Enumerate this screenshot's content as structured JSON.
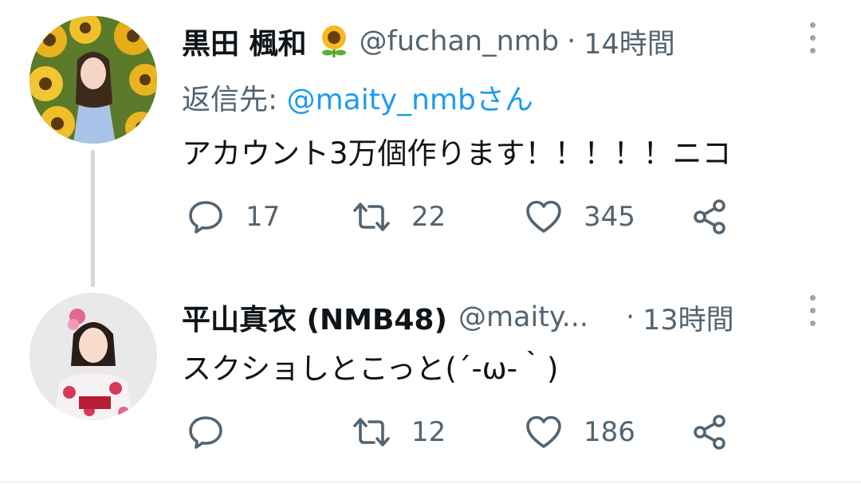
{
  "tweets": [
    {
      "display_name": "黒田 楓和",
      "name_emoji": "sunflower-emoji",
      "handle": "@fuchan_nmb",
      "separator": "·",
      "time": "14時間",
      "reply_label": "返信先: ",
      "reply_handle": "@maity_nmbさん",
      "text": "アカウント3万個作ります！！！！！ニコ",
      "replies": "17",
      "retweets": "22",
      "likes": "345"
    },
    {
      "display_name": "平山真衣 (NMB48)",
      "handle": "@maity...",
      "separator": "·",
      "time": "13時間",
      "text": "スクショしとこっと(´-ω-｀)",
      "replies": "",
      "retweets": "12",
      "likes": "186"
    }
  ],
  "icons": [
    "reply-icon",
    "retweet-icon",
    "like-icon",
    "share-icon",
    "more-icon"
  ],
  "colors": {
    "text": "#0f1419",
    "secondary": "#536471",
    "link": "#1d9bf0",
    "thread_line": "#cfd9de"
  }
}
